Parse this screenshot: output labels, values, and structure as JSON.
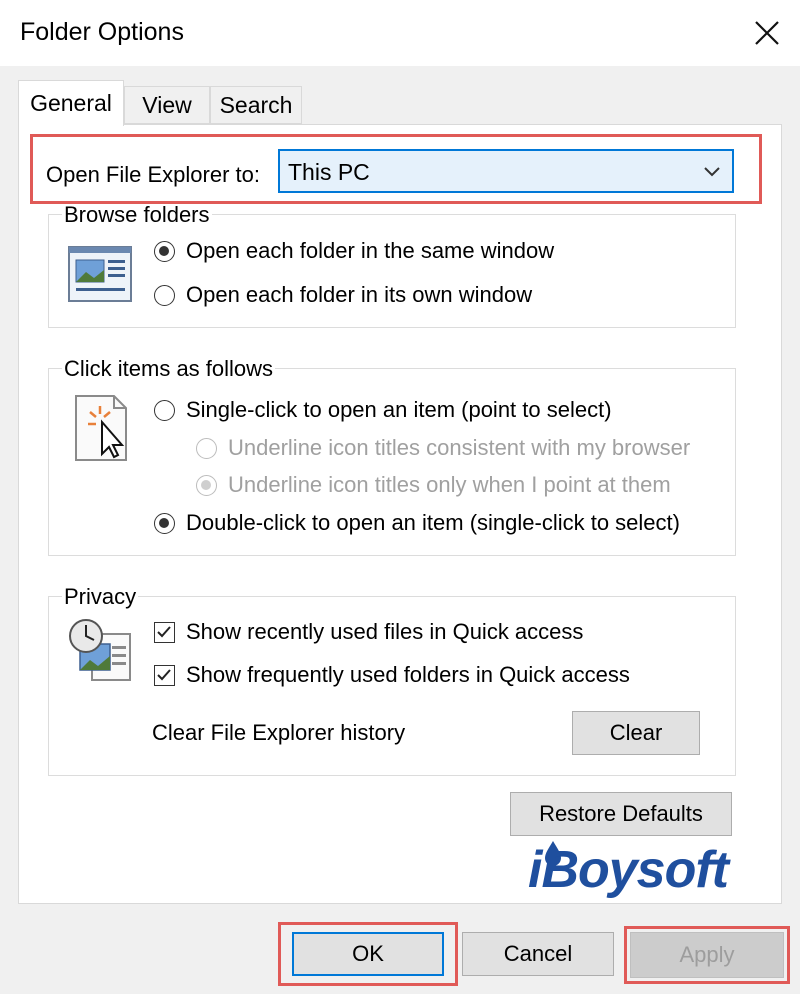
{
  "window": {
    "title": "Folder Options"
  },
  "tabs": [
    {
      "label": "General",
      "active": true
    },
    {
      "label": "View",
      "active": false
    },
    {
      "label": "Search",
      "active": false
    }
  ],
  "open_to": {
    "label": "Open File Explorer to:",
    "value": "This PC"
  },
  "browse": {
    "title": "Browse folders",
    "options": [
      {
        "label": "Open each folder in the same window",
        "checked": true
      },
      {
        "label": "Open each folder in its own window",
        "checked": false
      }
    ]
  },
  "click": {
    "title": "Click items as follows",
    "options": [
      {
        "label": "Single-click to open an item (point to select)",
        "checked": false,
        "enabled": true
      },
      {
        "label": "Underline icon titles consistent with my browser",
        "checked": false,
        "enabled": false
      },
      {
        "label": "Underline icon titles only when I point at them",
        "checked": true,
        "enabled": false
      },
      {
        "label": "Double-click to open an item (single-click to select)",
        "checked": true,
        "enabled": true
      }
    ]
  },
  "privacy": {
    "title": "Privacy",
    "checks": [
      {
        "label": "Show recently used files in Quick access",
        "checked": true
      },
      {
        "label": "Show frequently used folders in Quick access",
        "checked": true
      }
    ],
    "clear_label": "Clear File Explorer history",
    "clear_button": "Clear"
  },
  "restore_button": "Restore Defaults",
  "footer": {
    "ok": "OK",
    "cancel": "Cancel",
    "apply": "Apply"
  },
  "watermark": "iBoysoft",
  "colors": {
    "highlight": "#e05a57",
    "accent": "#0078d7",
    "combo_bg": "#e5f1fb",
    "logo": "#1f4f9e"
  }
}
